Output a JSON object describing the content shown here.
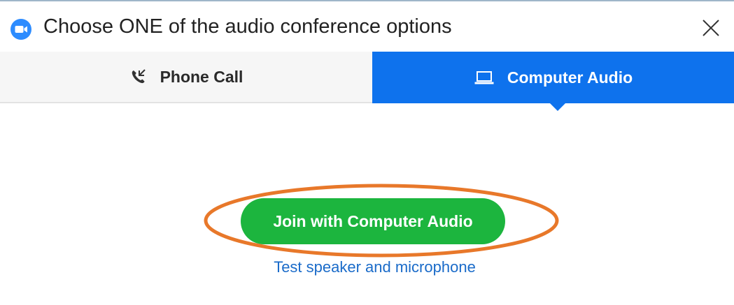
{
  "dialog": {
    "title": "Choose ONE of the audio conference options",
    "app_icon": "zoom-logo-icon",
    "close_icon": "close-icon",
    "accent_color": "#0e72ed"
  },
  "tabs": [
    {
      "label": "Phone Call",
      "icon": "phone-call-icon",
      "selected": false
    },
    {
      "label": "Computer Audio",
      "icon": "laptop-icon",
      "selected": true
    }
  ],
  "main": {
    "join_button_label": "Join with Computer Audio",
    "join_button_color": "#1cb53e",
    "test_link_label": "Test speaker and microphone",
    "highlight_color": "#e8782a"
  }
}
